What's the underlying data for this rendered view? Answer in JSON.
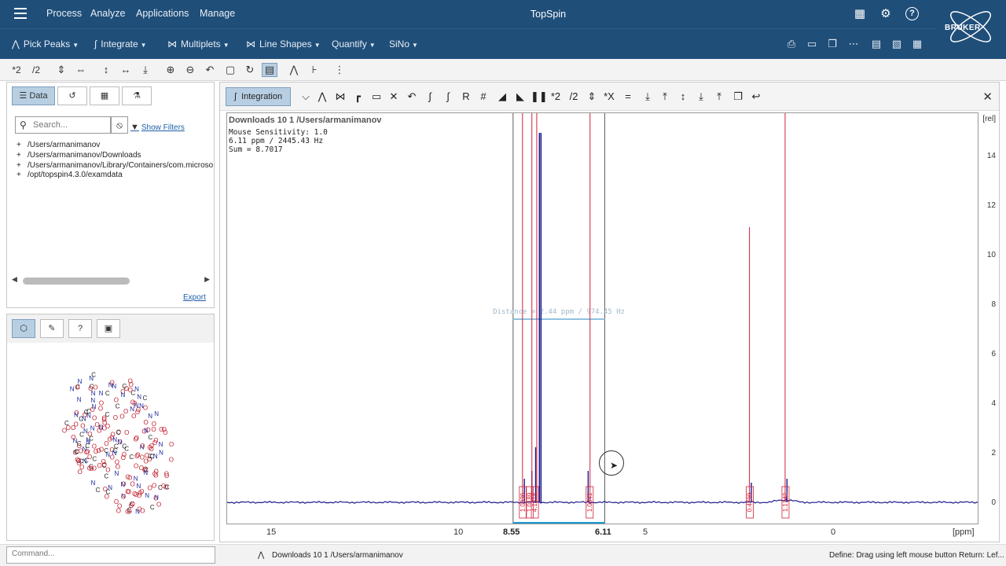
{
  "app": {
    "title": "TopSpin",
    "menus": [
      "Process",
      "Analyze",
      "Applications",
      "Manage"
    ],
    "brand": "BRUKER"
  },
  "analyze_bar": {
    "items": [
      "Pick Peaks",
      "Integrate",
      "Multiplets",
      "Line Shapes",
      "Quantify",
      "SiNo"
    ]
  },
  "toolbar": {
    "times2": "*2",
    "div2": "/2"
  },
  "data_browser": {
    "tab_data": "Data",
    "search_placeholder": "Search...",
    "show_filters": "Show Filters",
    "tree": [
      "/Users/armanimanov",
      "/Users/armanimanov/Downloads",
      "/Users/armanimanov/Library/Containers/com.microsoft",
      "/opt/topspin4.3.0/examdata"
    ],
    "export": "Export"
  },
  "spectrum": {
    "mode_button": "Integration",
    "tool_labels": {
      "R": "R",
      "hash": "#",
      "times2": "*2",
      "div2": "/2",
      "timesx": "*X",
      "equals": "="
    },
    "dataset_title": "Downloads  10  1  /Users/armanimanov",
    "info_lines": [
      "Mouse Sensitivity: 1.0",
      "6.11 ppm / 2445.43 Hz",
      "Sum = 8.7017"
    ],
    "distance_label": "Distance = 2.44 ppm / 974.45 Hz",
    "y_unit": "[rel]",
    "y_ticks": [
      "14",
      "12",
      "10",
      "8",
      "6",
      "4",
      "2",
      "0"
    ],
    "x_unit": "[ppm]",
    "x_ticks": [
      "15",
      "10",
      "5",
      "0"
    ],
    "x_selection": [
      "8.55",
      "6.11"
    ],
    "integral_labels": [
      "1.0036",
      "1.0189",
      "4.1618",
      "1.0641",
      "0.4799",
      "1.1742"
    ],
    "colors": {
      "spectrum": "#1a1a8c",
      "integral": "#d0203a",
      "selection": "#1a9ad6"
    }
  },
  "status": {
    "command_placeholder": "Command...",
    "dataset": "Downloads  10  1  /Users/armanimanov",
    "define_hint": "Define: Drag using left mouse button",
    "return_hint": "Return: Lef..."
  }
}
